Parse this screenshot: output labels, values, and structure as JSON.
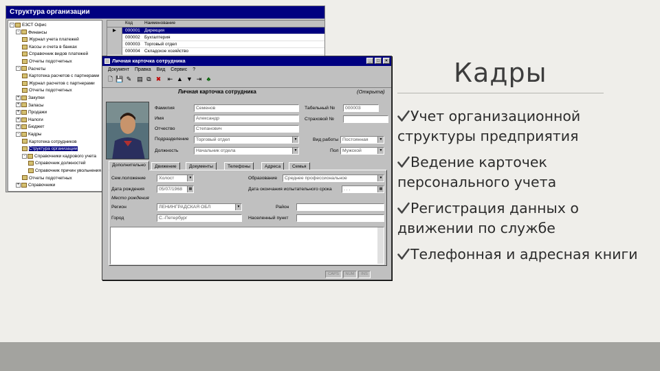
{
  "slide": {
    "title": "Кадры",
    "bullets": [
      "Учет организационной структуры предприятия",
      "Ведение карточек персонального учета",
      "Регистрация данных о движении по службе",
      "Телефонная и адресная книги"
    ]
  },
  "back_window": {
    "title": "Структура организации",
    "tree": [
      {
        "sign": "-",
        "label": "ЕЗСТ Офис",
        "level": 0
      },
      {
        "sign": "-",
        "label": "Финансы",
        "level": 1
      },
      {
        "sign": "",
        "label": "Журнал учета платежей",
        "level": 2
      },
      {
        "sign": "",
        "label": "Кассы и счета в банках",
        "level": 2
      },
      {
        "sign": "",
        "label": "Справочник видов платежей",
        "level": 2
      },
      {
        "sign": "",
        "label": "Отчеты подотчетных",
        "level": 2
      },
      {
        "sign": "-",
        "label": "Расчеты",
        "level": 1
      },
      {
        "sign": "",
        "label": "Картотека расчетов с партнерами",
        "level": 2
      },
      {
        "sign": "",
        "label": "Журнал расчетов с партнерами",
        "level": 2
      },
      {
        "sign": "",
        "label": "Отчеты подотчетных",
        "level": 2
      },
      {
        "sign": "+",
        "label": "Закупки",
        "level": 1
      },
      {
        "sign": "+",
        "label": "Запасы",
        "level": 1
      },
      {
        "sign": "+",
        "label": "Продажи",
        "level": 1
      },
      {
        "sign": "+",
        "label": "Налоги",
        "level": 1
      },
      {
        "sign": "+",
        "label": "Бюджет",
        "level": 1
      },
      {
        "sign": "-",
        "label": "Кадры",
        "level": 1
      },
      {
        "sign": "",
        "label": "Картотека сотрудников",
        "level": 2
      },
      {
        "sign": "",
        "label": "Структура организации",
        "level": 2,
        "selected": true
      },
      {
        "sign": "-",
        "label": "Справочники кадрового учета",
        "level": 2
      },
      {
        "sign": "",
        "label": "Справочник должностей",
        "level": 3
      },
      {
        "sign": "",
        "label": "Справочник причин увольнения",
        "level": 3
      },
      {
        "sign": "",
        "label": "Отчеты подотчетных",
        "level": 2
      },
      {
        "sign": "+",
        "label": "Справочники",
        "level": 1
      }
    ],
    "grid": {
      "headers": [
        "Код",
        "Наименование"
      ],
      "rows": [
        {
          "code": "000001",
          "name": "Дирекция",
          "selected": true
        },
        {
          "code": "000002",
          "name": "Бухгалтерия"
        },
        {
          "code": "000003",
          "name": "Торговый отдел"
        },
        {
          "code": "000004",
          "name": "Складское хозяйство"
        }
      ]
    }
  },
  "card_window": {
    "title": "Личная карточка сотрудника",
    "menu": [
      "Документ",
      "Правка",
      "Вид",
      "Сервис",
      "?"
    ],
    "heading": "Личная карточка сотрудника",
    "status": "(Открыта)",
    "labels": {
      "surname": "Фамилия",
      "name": "Имя",
      "patronymic": "Отчество",
      "department": "Подразделение",
      "position": "Должность",
      "tab_num": "Табельный №",
      "insurance": "Страховой №",
      "employment": "Вид работы",
      "sex": "Пол",
      "family": "Сем.положение",
      "birth": "Дата рождения",
      "education": "Образование",
      "probation_end": "Дата окончания испытательного срока",
      "residence_header": "Место рождения",
      "region": "Регион",
      "city": "Город",
      "district": "Район",
      "locality": "Населенный пункт"
    },
    "values": {
      "surname": "Семенов",
      "name": "Александр",
      "patronymic": "Степанович",
      "department": "Торговый отдел",
      "position": "Начальник отдела",
      "tab_num": "000003",
      "employment": "Постоянная",
      "sex": "Мужской",
      "family": "Холост",
      "birth": "05/07/1968",
      "education": "Среднее профессиональное",
      "probation_end": ". . .",
      "region": "ЛЕНИНГРАДСКАЯ ОБЛ",
      "city": "С.-Петербург"
    },
    "tabs": [
      "Дополнительно",
      "Движение",
      "Документы",
      "Телефоны",
      "Адреса",
      "Семья"
    ],
    "status_boxes": [
      "CAPS",
      "NUM",
      "INS"
    ]
  }
}
